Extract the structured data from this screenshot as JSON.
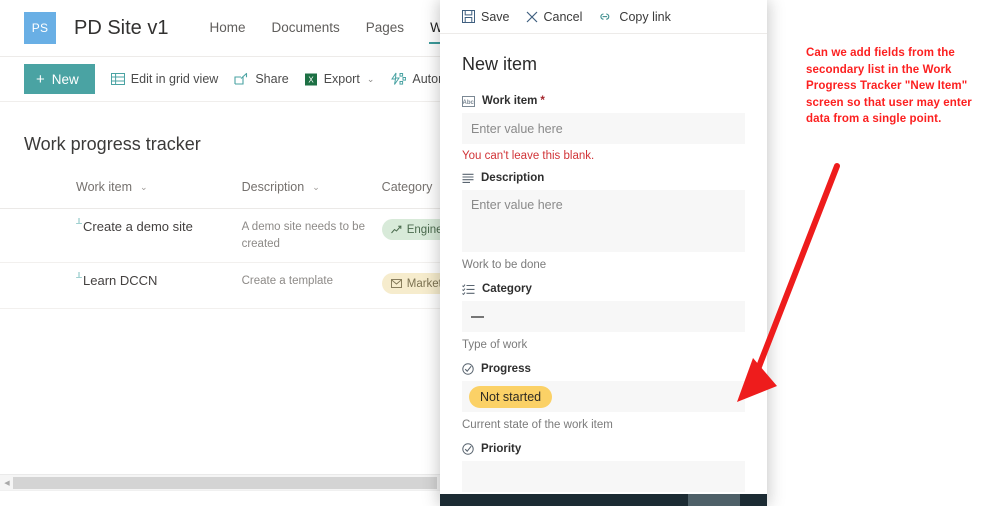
{
  "site": {
    "logo_text": "PS",
    "title": "PD Site v1",
    "nav": [
      {
        "label": "Home",
        "active": false
      },
      {
        "label": "Documents",
        "active": false
      },
      {
        "label": "Pages",
        "active": false
      },
      {
        "label": "Work p",
        "active": true
      }
    ]
  },
  "commandbar": {
    "new_label": "New",
    "new_plus": "+",
    "items": [
      {
        "label": "Edit in grid view",
        "icon": "grid-icon",
        "has_chevron": false
      },
      {
        "label": "Share",
        "icon": "share-icon",
        "has_chevron": false
      },
      {
        "label": "Export",
        "icon": "excel-icon",
        "has_chevron": true
      },
      {
        "label": "Automa",
        "icon": "automate-icon",
        "has_chevron": false
      }
    ],
    "chevron": "⌄"
  },
  "list": {
    "title": "Work progress tracker",
    "columns": [
      {
        "label": "Work item"
      },
      {
        "label": "Description"
      },
      {
        "label": "Category"
      }
    ],
    "rows": [
      {
        "work_item": "Create a demo site",
        "description": "A demo site needs to be created",
        "category": "Engineerin",
        "category_style": "green",
        "category_icon": "trending-up-icon"
      },
      {
        "work_item": "Learn DCCN",
        "description": "Create a template",
        "category": "Marketing",
        "category_style": "tan",
        "category_icon": "envelope-icon"
      }
    ]
  },
  "panel": {
    "commands": [
      {
        "label": "Save",
        "icon": "save-icon"
      },
      {
        "label": "Cancel",
        "icon": "close-icon"
      },
      {
        "label": "Copy link",
        "icon": "link-icon"
      }
    ],
    "title": "New item",
    "fields": [
      {
        "label": "Work item",
        "icon": "abc-text-icon",
        "required": true,
        "required_mark": "*",
        "placeholder": "Enter value here",
        "value": "",
        "error": "You can't leave this blank.",
        "help": "",
        "type": "text"
      },
      {
        "label": "Description",
        "icon": "multiline-text-icon",
        "required": false,
        "required_mark": "",
        "placeholder": "Enter value here",
        "value": "",
        "error": "",
        "help": "Work to be done",
        "type": "multiline"
      },
      {
        "label": "Category",
        "icon": "choice-list-icon",
        "required": false,
        "required_mark": "",
        "placeholder": "",
        "value": "—",
        "error": "",
        "help": "Type of work",
        "type": "dash"
      },
      {
        "label": "Progress",
        "icon": "choice-circle-icon",
        "required": false,
        "required_mark": "",
        "placeholder": "",
        "value": "Not started",
        "error": "",
        "help": "Current state of the work item",
        "type": "pill"
      },
      {
        "label": "Priority",
        "icon": "choice-circle-icon",
        "required": false,
        "required_mark": "",
        "placeholder": "",
        "value": "",
        "error": "",
        "help": "",
        "type": "empty"
      }
    ]
  },
  "annotation": {
    "text": "Can we add fields from the secondary list in the Work Progress Tracker \"New Item\" screen so that user may enter data from a single point.",
    "color": "#fc2020"
  },
  "colors": {
    "accent_teal": "#4aa3a3",
    "logo_blue": "#69afe5",
    "pill_yellow": "#fbd166",
    "pill_green": "#d8ead9",
    "pill_tan": "#f6eccd",
    "error_red": "#d13438",
    "annotation_red": "#fc2020"
  }
}
